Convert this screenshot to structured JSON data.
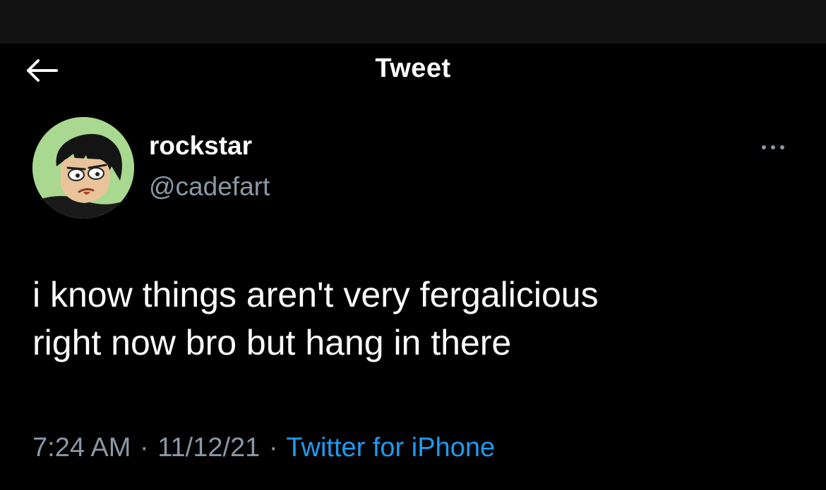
{
  "header": {
    "back_icon": "arrow-left-icon",
    "title": "Tweet"
  },
  "tweet": {
    "author": {
      "display_name": "rockstar",
      "handle": "@cadefart",
      "avatar": "cartoon-avatar"
    },
    "more_icon": "more-horizontal-icon",
    "text_lines": [
      "i know things aren't very fergalicious",
      "right now bro but hang in there"
    ],
    "meta": {
      "time": "7:24 AM",
      "date": "11/12/21",
      "source": "Twitter for iPhone",
      "separator": "·"
    }
  },
  "colors": {
    "background": "#000000",
    "status_bar": "#121212",
    "primary_text": "#ffffff",
    "secondary_text": "#8b98a5",
    "link": "#1d9bf0"
  }
}
